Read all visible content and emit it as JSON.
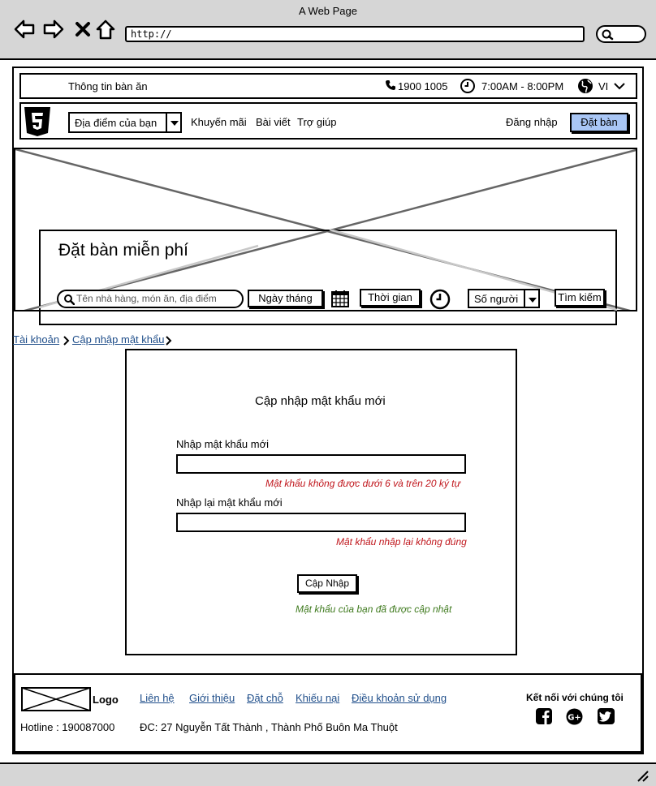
{
  "browser": {
    "window_title": "A Web Page",
    "url": "http://"
  },
  "topbar": {
    "site_info": "Thông tin bàn ăn",
    "phone": "1900 1005",
    "hours": "7:00AM - 8:00PM",
    "language": "VI"
  },
  "navbar": {
    "location_select": "Địa điểm của bạn",
    "links": [
      "Khuyến mãi",
      "Bài viết",
      "Trợ giúp"
    ],
    "login": "Đăng nhập",
    "book_button": "Đặt bàn"
  },
  "booking": {
    "title": "Đặt bàn miễn phí",
    "search_placeholder": "Tên nhà hàng, món ăn, địa điểm",
    "date_label": "Ngày tháng",
    "time_label": "Thời gian",
    "people_select": "Số người",
    "search_button": "Tìm kiếm"
  },
  "breadcrumb": [
    "Tài khoản",
    "Cập nhập mật khẩu"
  ],
  "form": {
    "title": "Cập nhập mật khẩu mới",
    "new_password_label": "Nhập mật khẩu mới",
    "new_password_error": "Mật khẩu không được dưới 6 và trên 20 ký tự",
    "confirm_label": "Nhập lại mật khẩu mới",
    "confirm_error": "Mật khẩu nhập lại không đúng",
    "submit": "Cập Nhập",
    "success": "Mật khẩu của bạn đã được cập nhật"
  },
  "footer": {
    "logo": "Logo",
    "links": [
      "Liên hệ",
      "Giới thiệu",
      "Đặt chỗ",
      "Khiếu nại",
      "Điều khoản sử dụng"
    ],
    "hotline": "Hotline : 190087000",
    "address": "ĐC: 27 Nguyễn Tất Thành , Thành Phố Buôn Ma Thuột",
    "social_title": "Kết nối với chúng tôi",
    "social_icons": [
      "facebook-icon",
      "google-plus-icon",
      "twitter-icon"
    ]
  },
  "colors": {
    "chrome": "#d6d6d6",
    "link": "#1f4e8a",
    "error": "#c0161c",
    "success": "#3f7a1e",
    "primary_button": "#a9c6f5"
  }
}
